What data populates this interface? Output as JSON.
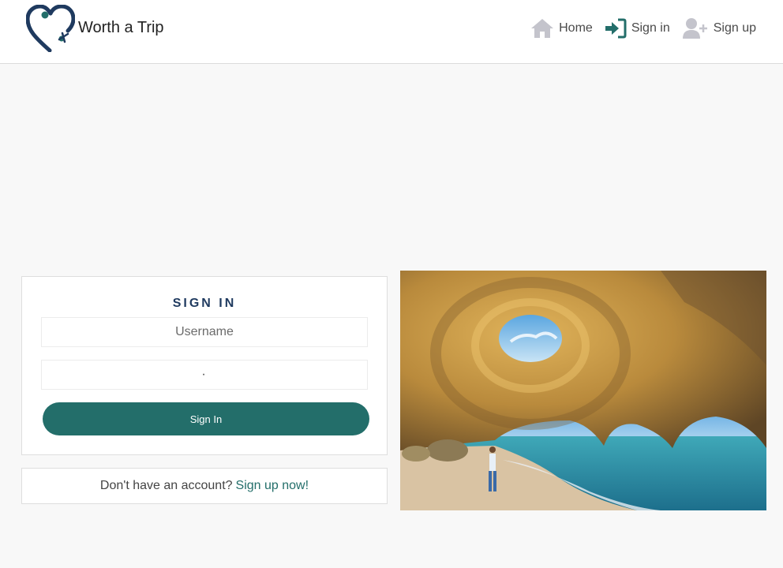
{
  "brand": {
    "name": "Worth a Trip",
    "logo_icon": "heart-plane-logo",
    "logo_color": "#1f3a5f"
  },
  "nav": {
    "items": [
      {
        "label": "Home",
        "icon": "home-icon"
      },
      {
        "label": "Sign in",
        "icon": "sign-in-icon"
      },
      {
        "label": "Sign up",
        "icon": "user-plus-icon"
      }
    ]
  },
  "signin": {
    "title": "SIGN IN",
    "username_placeholder": "Username",
    "password_value": "·",
    "button_label": "Sign In"
  },
  "signup_prompt": {
    "text": "Don't have an account?",
    "link_label": "Sign up now!"
  },
  "hero": {
    "image": "sea-cave-beach-photo"
  },
  "colors": {
    "accent": "#236e6a",
    "title": "#1f3a5f",
    "icon_gray": "#c4c4cc"
  }
}
